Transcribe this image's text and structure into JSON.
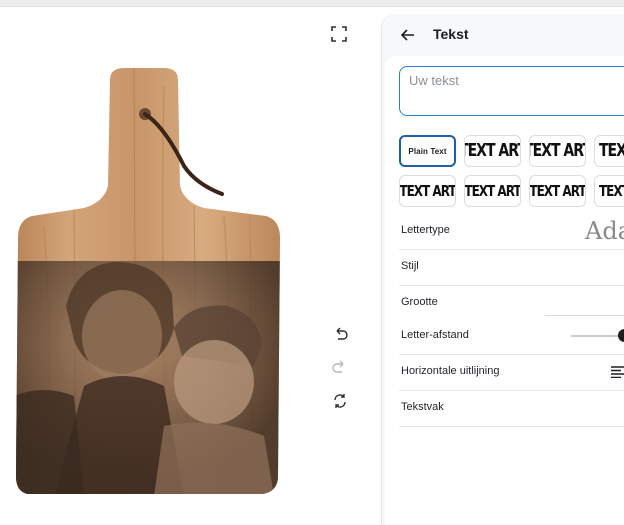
{
  "colors": {
    "accent": "#2c7cd6",
    "selected_border": "#1f5fa8",
    "panel_bg": "#f7f8f9"
  },
  "canvas": {
    "fullscreen_icon": "expand-icon",
    "product": "engraved-cutting-board-photo",
    "tools": {
      "undo_icon": "undo-icon",
      "redo_icon": "redo-icon",
      "rotate_icon": "rotate-icon"
    }
  },
  "panel": {
    "title": "Tekst",
    "back_icon": "arrow-left-icon",
    "text_input": {
      "placeholder": "Uw tekst",
      "value": ""
    },
    "styles": [
      {
        "label": "Plain Text",
        "selected": true
      },
      {
        "label": "TEXT ART",
        "selected": false
      },
      {
        "label": "TEXT ART",
        "selected": false
      },
      {
        "label": "TEXT",
        "selected": false
      },
      {
        "label": "TEXT ART",
        "selected": false
      },
      {
        "label": "TEXT ART",
        "selected": false
      },
      {
        "label": "TEXT ART",
        "selected": false
      },
      {
        "label": "TEXT",
        "selected": false
      }
    ],
    "properties": {
      "font_label": "Lettertype",
      "font_value": "Ada",
      "style_label": "Stijl",
      "size_label": "Grootte",
      "spacing_label": "Letter-afstand",
      "spacing_value": 0.8,
      "align_label": "Horizontale uitlijning",
      "align_icon": "align-left-icon",
      "textbox_label": "Tekstvak"
    }
  }
}
